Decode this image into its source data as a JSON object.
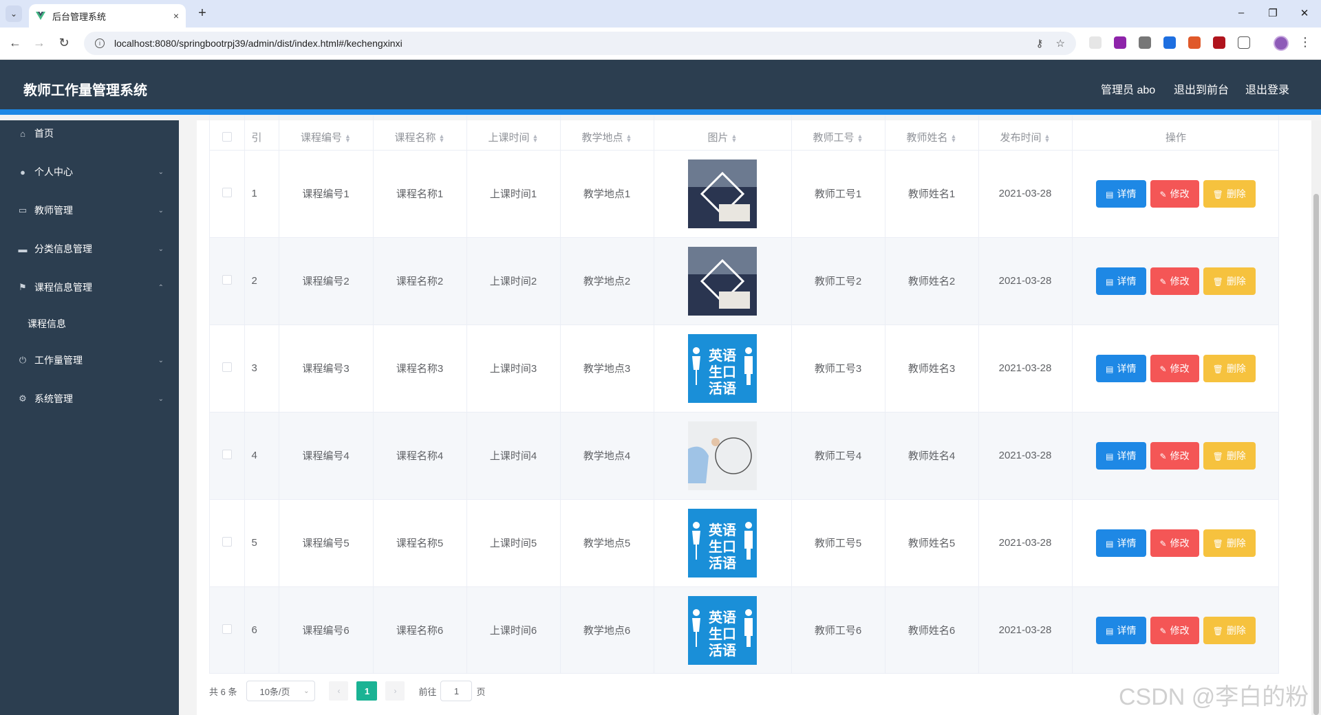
{
  "browser": {
    "tab_title": "后台管理系统",
    "tab_close": "×",
    "new_tab": "+",
    "url": "localhost:8080/springbootrpj39/admin/dist/index.html#/kechengxinxi",
    "win_min": "–",
    "win_max": "❐",
    "win_close": "✕"
  },
  "header": {
    "title": "教师工作量管理系统",
    "admin": "管理员 abo",
    "to_front": "退出到前台",
    "logout": "退出登录"
  },
  "sidebar": {
    "items": [
      {
        "label": "首页",
        "icon": "home-icon"
      },
      {
        "label": "个人中心",
        "icon": "user-icon"
      },
      {
        "label": "教师管理",
        "icon": "chat-icon"
      },
      {
        "label": "分类信息管理",
        "icon": "message-icon"
      },
      {
        "label": "课程信息管理",
        "icon": "flag-icon"
      },
      {
        "label": "课程信息",
        "icon": ""
      },
      {
        "label": "工作量管理",
        "icon": "power-icon"
      },
      {
        "label": "系统管理",
        "icon": "settings-icon"
      }
    ]
  },
  "table": {
    "headers": [
      "索引",
      "课程编号",
      "课程名称",
      "上课时间",
      "教学地点",
      "图片",
      "教师工号",
      "教师姓名",
      "发布时间",
      "操作"
    ],
    "index_header_visible": "引",
    "rows": [
      {
        "idx": "1",
        "code": "课程编号1",
        "name": "课程名称1",
        "time": "上课时间1",
        "place": "教学地点1",
        "img": "photo-suit",
        "tno": "教师工号1",
        "tname": "教师姓名1",
        "date": "2021-03-28"
      },
      {
        "idx": "2",
        "code": "课程编号2",
        "name": "课程名称2",
        "time": "上课时间2",
        "place": "教学地点2",
        "img": "photo-suit",
        "tno": "教师工号2",
        "tname": "教师姓名2",
        "date": "2021-03-28"
      },
      {
        "idx": "3",
        "code": "课程编号3",
        "name": "课程名称3",
        "time": "上课时间3",
        "place": "教学地点3",
        "img": "english-poster",
        "tno": "教师工号3",
        "tname": "教师姓名3",
        "date": "2021-03-28"
      },
      {
        "idx": "4",
        "code": "课程编号4",
        "name": "课程名称4",
        "time": "上课时间4",
        "place": "教学地点4",
        "img": "photo-index",
        "tno": "教师工号4",
        "tname": "教师姓名4",
        "date": "2021-03-28"
      },
      {
        "idx": "5",
        "code": "课程编号5",
        "name": "课程名称5",
        "time": "上课时间5",
        "place": "教学地点5",
        "img": "english-poster",
        "tno": "教师工号5",
        "tname": "教师姓名5",
        "date": "2021-03-28"
      },
      {
        "idx": "6",
        "code": "课程编号6",
        "name": "课程名称6",
        "time": "上课时间6",
        "place": "教学地点6",
        "img": "english-poster",
        "tno": "教师工号6",
        "tname": "教师姓名6",
        "date": "2021-03-28"
      }
    ],
    "actions": {
      "detail": "详情",
      "edit": "修改",
      "delete": "删除"
    },
    "poster_text": [
      "英语",
      "生口",
      "活语"
    ]
  },
  "pagination": {
    "total": "共 6 条",
    "page_size": "10条/页",
    "current": "1",
    "goto_label": "前往",
    "goto_value": "1",
    "page_unit": "页"
  },
  "watermark": "CSDN @李白的粉",
  "colors": {
    "header_bg": "#2c3e50",
    "accent": "#1e88e5",
    "danger": "#f45656",
    "warning": "#f6c23e",
    "page_active": "#1ab394"
  }
}
